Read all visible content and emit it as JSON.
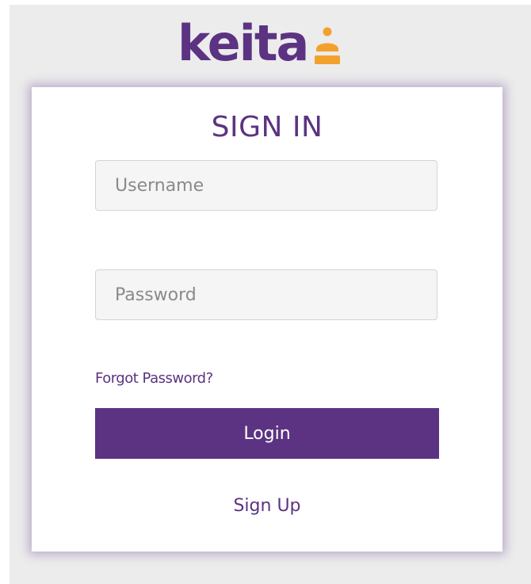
{
  "brand": {
    "name": "keita",
    "text_color": "#5c3382",
    "mark_color": "#f2a12e",
    "mark_icon": "person-icon"
  },
  "signin": {
    "title": "SIGN IN",
    "username_placeholder": "Username",
    "password_placeholder": "Password",
    "forgot_label": "Forgot Password?",
    "login_label": "Login",
    "signup_label": "Sign Up"
  },
  "colors": {
    "accent": "#5c3382",
    "background": "#ececec",
    "card": "#ffffff"
  }
}
